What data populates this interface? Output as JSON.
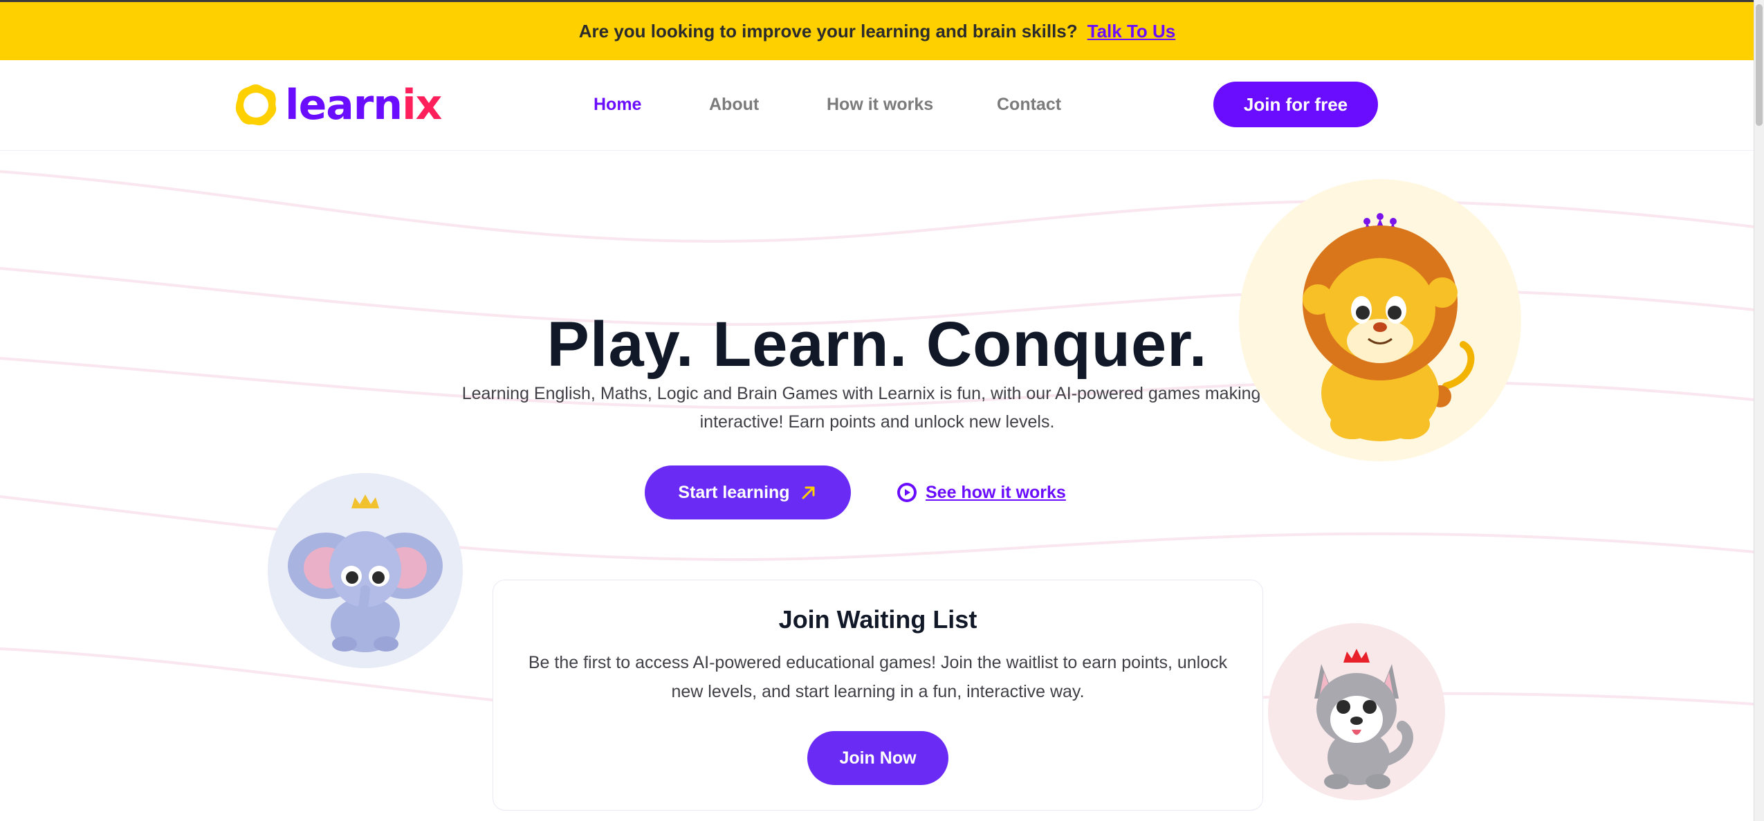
{
  "banner": {
    "text": "Are you looking to improve your learning and brain skills?",
    "link": "Talk To Us"
  },
  "nav": {
    "logo_text_part1": "learn",
    "logo_text_part2": "ix",
    "links": [
      "Home",
      "About",
      "How it works",
      "Contact"
    ],
    "active": "Home",
    "cta": "Join for free"
  },
  "hero": {
    "title": "Play. Learn. Conquer.",
    "subtitle": "Learning English, Maths, Logic and Brain Games with Learnix is fun, with our AI-powered games making K-6 interactive! Earn points and unlock new levels.",
    "start_button": "Start learning",
    "how_link": "See how it works"
  },
  "waitlist": {
    "title": "Join Waiting List",
    "text": "Be the first to access AI-powered educational games! Join the waitlist to earn points, unlock new levels, and start learning in a fun, interactive way.",
    "button": "Join Now"
  },
  "icons": [
    "logo-ring-icon",
    "arrow-up-right-icon",
    "play-circle-icon",
    "lion-mascot",
    "elephant-mascot",
    "husky-mascot",
    "crown-icon"
  ],
  "colors": {
    "banner": "#FFD000",
    "brand_purple": "#6A0DFF",
    "button_purple": "#6A2CF5",
    "logo_red": "#FF1F5A",
    "heading": "#111827"
  }
}
